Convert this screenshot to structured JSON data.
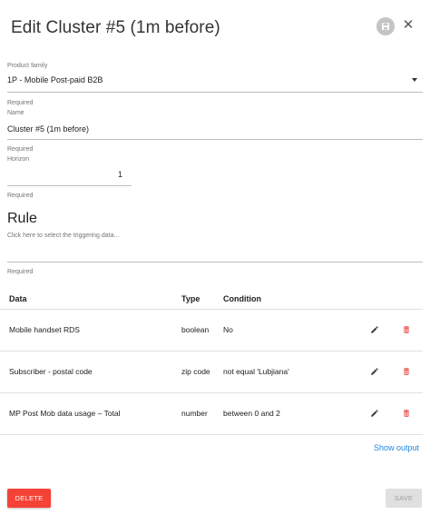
{
  "dialog": {
    "title": "Edit Cluster #5 (1m before)",
    "save_icon": "floppy-disk-icon",
    "close_label": "✕"
  },
  "product_family": {
    "label": "Product family",
    "value": "1P - Mobile Post-paid B2B",
    "required": "Required"
  },
  "name": {
    "label": "Name",
    "value": "Cluster #5 (1m before)",
    "required": "Required"
  },
  "horizon": {
    "label": "Horizon",
    "value": "1",
    "required": "Required"
  },
  "rule": {
    "title": "Rule",
    "placeholder": "Click here to select the triggering data...",
    "required": "Required"
  },
  "table": {
    "headers": {
      "data": "Data",
      "type": "Type",
      "condition": "Condition"
    },
    "rows": [
      {
        "data": "Mobile handset RDS",
        "type": "boolean",
        "condition": "No"
      },
      {
        "data": "Subscriber - postal code",
        "type": "zip code",
        "condition": "not equal 'Lubjiana'"
      },
      {
        "data": "MP Post Mob data usage – Total",
        "type": "number",
        "condition": "between 0 and 2"
      }
    ],
    "edit_icon": "pencil-icon",
    "delete_icon": "trash-icon"
  },
  "show_output": "Show output",
  "actions": {
    "delete_label": "DELETE",
    "save_label": "SAVE"
  },
  "colors": {
    "delete": "#f44336",
    "link": "#1e88e5",
    "trash_icon": "#e53935"
  }
}
